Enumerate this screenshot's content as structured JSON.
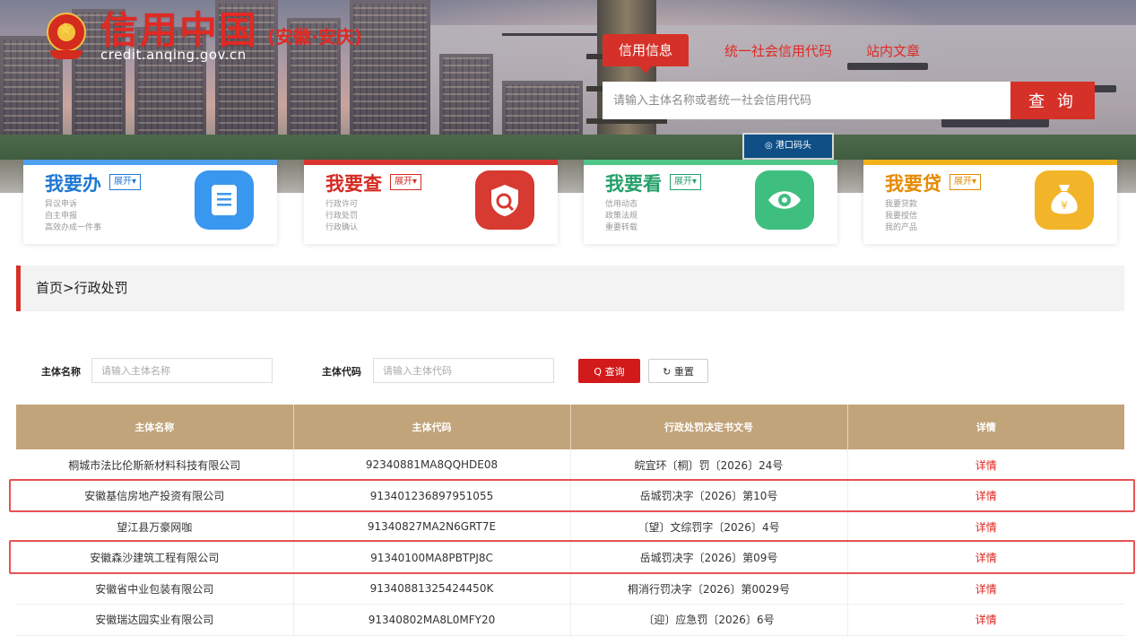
{
  "header": {
    "logo_main": "信用中国",
    "logo_region": "(安徽·安庆)",
    "logo_url": "credit.anqing.gov.cn",
    "hero_sign": "◎ 港口码头"
  },
  "search": {
    "tabs": [
      {
        "label": "信用信息",
        "active": true
      },
      {
        "label": "统一社会信用代码",
        "active": false
      },
      {
        "label": "站内文章",
        "active": false
      }
    ],
    "placeholder": "请输入主体名称或者统一社会信用代码",
    "button": "查 询"
  },
  "cards": [
    {
      "title": "我要办",
      "expand": "展开▾",
      "color": "#1e78d2",
      "bar": "#4d9ff0",
      "icon": "document-icon",
      "icon_bg": "#3a97f0",
      "links": [
        "异议申诉",
        "自主申报",
        "高效办成一件事"
      ]
    },
    {
      "title": "我要查",
      "expand": "展开▾",
      "color": "#d42a22",
      "bar": "#d9362f",
      "icon": "shield-search-icon",
      "icon_bg": "#d63a30",
      "links": [
        "行政许可",
        "行政处罚",
        "行政确认"
      ]
    },
    {
      "title": "我要看",
      "expand": "展开▾",
      "color": "#25a06a",
      "bar": "#4fc788",
      "icon": "eye-icon",
      "icon_bg": "#3fbf7f",
      "links": [
        "信用动态",
        "政策法规",
        "重要转载"
      ]
    },
    {
      "title": "我要贷",
      "expand": "展开▾",
      "color": "#e68a00",
      "bar": "#f3b21c",
      "icon": "money-bag-icon",
      "icon_bg": "#f2b428",
      "links": [
        "我要贷款",
        "我要授信",
        "我的产品"
      ]
    }
  ],
  "breadcrumb": "首页>行政处罚",
  "filter": {
    "name_label": "主体名称",
    "name_placeholder": "请输入主体名称",
    "code_label": "主体代码",
    "code_placeholder": "请输入主体代码",
    "query_button": "Q 查询",
    "reset_button": "↻ 重置"
  },
  "table": {
    "columns": [
      "主体名称",
      "主体代码",
      "行政处罚决定书文号",
      "详情"
    ],
    "rows": [
      [
        "桐城市法比伦斯新材料科技有限公司",
        "92340881MA8QQHDE08",
        "皖宜环〔桐〕罚〔2026〕24号",
        "详情"
      ],
      [
        "安徽基信房地产投资有限公司",
        "913401236897951055",
        "岳城罚决字〔2026〕第10号",
        "详情"
      ],
      [
        "望江县万豪网咖",
        "91340827MA2N6GRT7E",
        "〔望〕文综罚字〔2026〕4号",
        "详情"
      ],
      [
        "安徽森沙建筑工程有限公司",
        "91340100MA8PBTPJ8C",
        "岳城罚决字〔2026〕第09号",
        "详情"
      ],
      [
        "安徽省中业包装有限公司",
        "91340881325424450K",
        "桐消行罚决字〔2026〕第0029号",
        "详情"
      ],
      [
        "安徽瑞达园实业有限公司",
        "91340802MA8L0MFY20",
        "〔迎〕应急罚〔2026〕6号",
        "详情"
      ]
    ]
  },
  "highlighted_rows": [
    2,
    4
  ]
}
